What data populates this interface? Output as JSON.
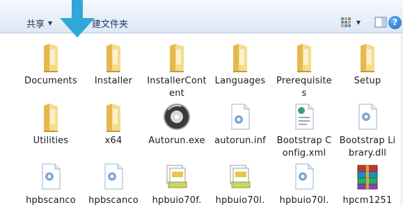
{
  "toolbar": {
    "share_label": "共享",
    "new_folder_label": "建文件夹",
    "help_label": "?"
  },
  "items": [
    {
      "label": "Documents",
      "type": "folder"
    },
    {
      "label": "Installer",
      "type": "folder"
    },
    {
      "label": "InstallerContent",
      "type": "folder"
    },
    {
      "label": "Languages",
      "type": "folder"
    },
    {
      "label": "Prerequisites",
      "type": "folder"
    },
    {
      "label": "Setup",
      "type": "folder"
    },
    {
      "label": "Utilities",
      "type": "folder"
    },
    {
      "label": "x64",
      "type": "folder"
    },
    {
      "label": "Autorun.exe",
      "type": "disc-app"
    },
    {
      "label": "autorun.inf",
      "type": "config"
    },
    {
      "label": "Bootstrap Config.xml",
      "type": "xml"
    },
    {
      "label": "Bootstrap Library.dll",
      "type": "config"
    },
    {
      "label": "hpbscanco",
      "type": "config"
    },
    {
      "label": "hpbscanco",
      "type": "config"
    },
    {
      "label": "hpbuio70f.",
      "type": "batch"
    },
    {
      "label": "hpbuio70l.",
      "type": "batch"
    },
    {
      "label": "hpbuio70l.",
      "type": "config"
    },
    {
      "label": "hpcm1251",
      "type": "archive"
    }
  ],
  "colors": {
    "arrow": "#2da8d8",
    "folder": "#f2d27a",
    "toolbar_text": "#1e395b"
  }
}
